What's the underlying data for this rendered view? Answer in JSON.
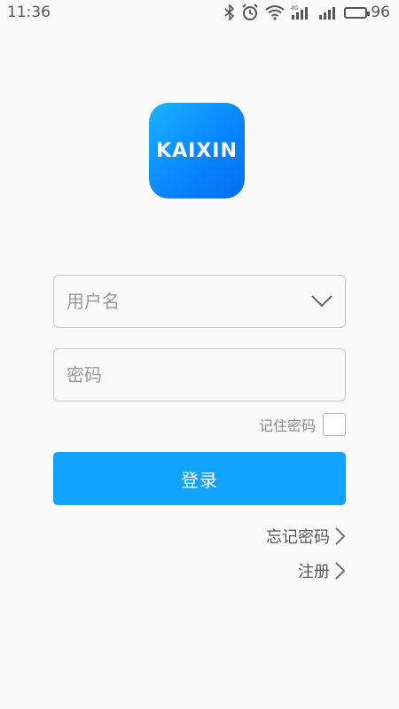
{
  "status_bar": {
    "time": "11:36",
    "battery_level": "96",
    "network_label": "4G",
    "icons": [
      "bluetooth-icon",
      "alarm-icon",
      "wifi-icon",
      "signal-icon",
      "battery-icon"
    ]
  },
  "app": {
    "logo_text": "KAIXIN",
    "logo_color": "#0a85ff"
  },
  "form": {
    "username_placeholder": "用户名",
    "username_value": "",
    "password_placeholder": "密码",
    "password_value": "",
    "remember_label": "记住密码",
    "remember_checked": false,
    "login_label": "登录",
    "accent_color": "#0fa2ff"
  },
  "links": {
    "forgot_password": "忘记密码",
    "register": "注册"
  }
}
